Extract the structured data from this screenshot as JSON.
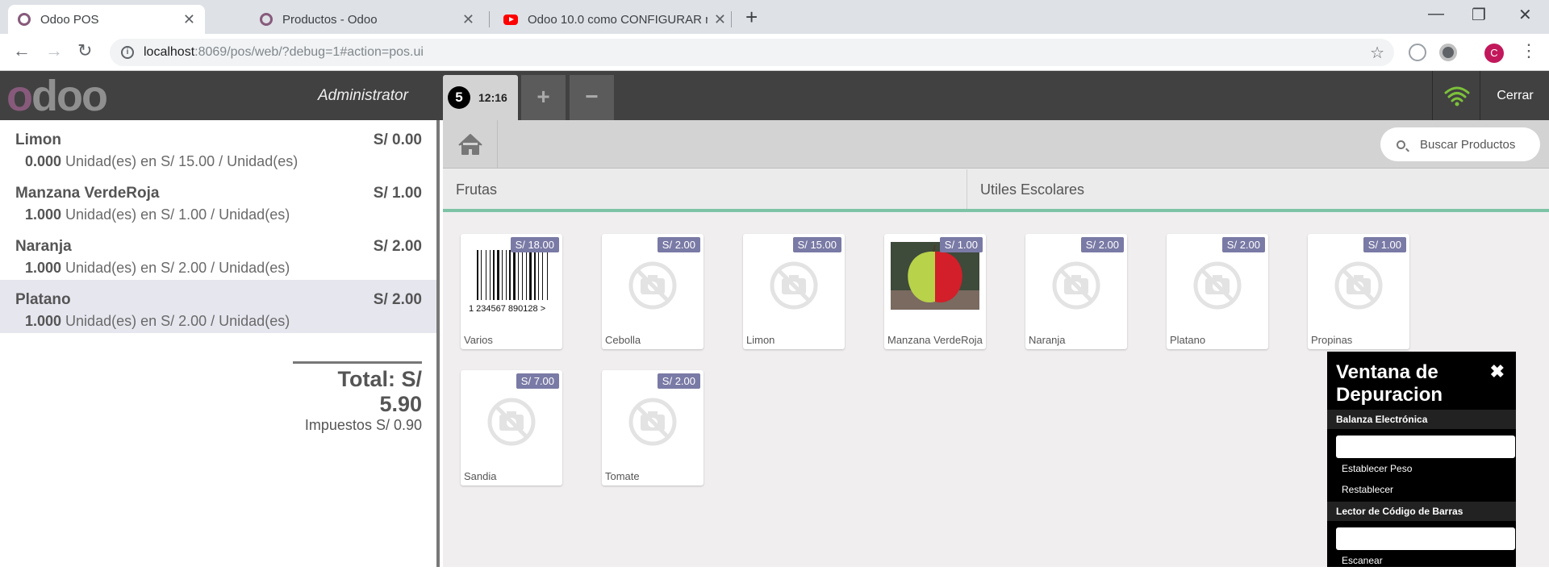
{
  "browser": {
    "tabs": [
      {
        "title": "Odoo POS",
        "favicon": "odoo-icon",
        "active": true
      },
      {
        "title": "Productos - Odoo",
        "favicon": "odoo-icon",
        "active": false
      },
      {
        "title": "Odoo 10.0 como CONFIGURAR m",
        "favicon": "youtube-icon",
        "active": false
      }
    ],
    "new_tab": "+",
    "url_host": "localhost",
    "url_path": ":8069/pos/web/?debug=1#action=pos.ui",
    "profile_initial": "C"
  },
  "pos": {
    "logo_first": "o",
    "logo_rest": "doo",
    "username": "Administrator",
    "order_tab": {
      "sequence": "5",
      "time": "12:16"
    },
    "add_order": "+",
    "remove_order": "−",
    "close_label": "Cerrar",
    "wifi_color": "#7cc13a"
  },
  "orderlines": [
    {
      "name": "Limon",
      "price": "S/ 0.00",
      "qty": "0.000",
      "info": " Unidad(es) en S/ 15.00 / Unidad(es)",
      "selected": false
    },
    {
      "name": "Manzana VerdeRoja",
      "price": "S/ 1.00",
      "qty": "1.000",
      "info": " Unidad(es) en S/ 1.00 / Unidad(es)",
      "selected": false
    },
    {
      "name": "Naranja",
      "price": "S/ 2.00",
      "qty": "1.000",
      "info": " Unidad(es) en S/ 2.00 / Unidad(es)",
      "selected": false
    },
    {
      "name": "Platano",
      "price": "S/ 2.00",
      "qty": "1.000",
      "info": " Unidad(es) en S/ 2.00 / Unidad(es)",
      "selected": true
    }
  ],
  "summary": {
    "total": "Total: S/ 5.90",
    "taxes": "Impuestos S/ 0.90"
  },
  "search_placeholder": "Buscar Productos",
  "categories": [
    "Frutas",
    "Utiles Escolares"
  ],
  "products": [
    {
      "name": "Varios",
      "price": "S/ 18.00",
      "image": "barcode",
      "barcode_text": "1 234567 890128 >"
    },
    {
      "name": "Cebolla",
      "price": "S/ 2.00",
      "image": "no-image"
    },
    {
      "name": "Limon",
      "price": "S/ 15.00",
      "image": "no-image"
    },
    {
      "name": "Manzana VerdeRoja",
      "price": "S/ 1.00",
      "image": "apple"
    },
    {
      "name": "Naranja",
      "price": "S/ 2.00",
      "image": "no-image"
    },
    {
      "name": "Platano",
      "price": "S/ 2.00",
      "image": "no-image"
    },
    {
      "name": "Propinas",
      "price": "S/ 1.00",
      "image": "no-image"
    },
    {
      "name": "Sandia",
      "price": "S/ 7.00",
      "image": "no-image"
    },
    {
      "name": "Tomate",
      "price": "S/ 2.00",
      "image": "no-image"
    }
  ],
  "debug": {
    "close": "✖",
    "title": "Ventana de Depuracion",
    "scale_section": "Balanza Electrónica",
    "set_weight": "Establecer Peso",
    "reset": "Restablecer",
    "barcode_section": "Lector de Código de Barras",
    "scan": "Escanear"
  }
}
